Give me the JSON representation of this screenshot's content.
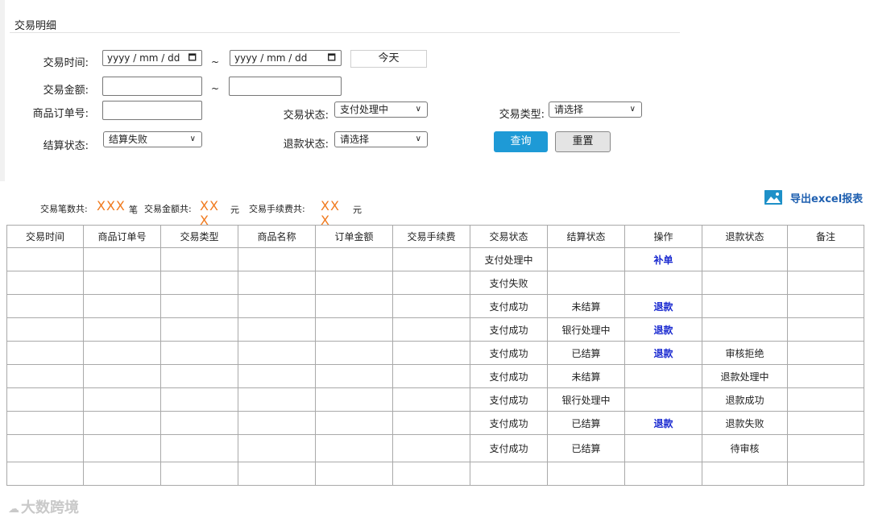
{
  "section": {
    "title": "交易明细"
  },
  "filters": {
    "trade_time_label": "交易时间:",
    "date_start_placeholder": "yyyy / mm / dd",
    "date_end_placeholder": "yyyy / mm / dd",
    "range_sep": "~",
    "today_button": "今天",
    "amount_label": "交易金额:",
    "order_no_label": "商品订单号:",
    "trade_status_label": "交易状态:",
    "trade_status_value": "支付处理中",
    "trade_type_label": "交易类型:",
    "trade_type_value": "请选择",
    "settle_status_label": "结算状态:",
    "settle_status_value": "结算失败",
    "refund_status_label": "退款状态:",
    "refund_status_value": "请选择",
    "query_button": "查询",
    "reset_button": "重置"
  },
  "summary": {
    "count_label": "交易笔数共:",
    "count_value": "XXX",
    "count_unit": "笔",
    "amount_label": "交易金额共:",
    "amount_value_line1": "XX",
    "amount_value_line2": "X",
    "amount_unit": "元",
    "fee_label": "交易手续费共:",
    "fee_value_line1": "XX",
    "fee_value_line2": "X",
    "fee_unit": "元"
  },
  "export": {
    "label": "导出excel报表",
    "icon": "image-icon"
  },
  "table": {
    "columns": [
      "交易时间",
      "商品订单号",
      "交易类型",
      "商品名称",
      "订单金额",
      "交易手续费",
      "交易状态",
      "结算状态",
      "操作",
      "退款状态",
      "备注"
    ],
    "rows": [
      [
        "",
        "",
        "",
        "",
        "",
        "",
        "支付处理中",
        "",
        "补单",
        "",
        ""
      ],
      [
        "",
        "",
        "",
        "",
        "",
        "",
        "支付失败",
        "",
        "",
        "",
        ""
      ],
      [
        "",
        "",
        "",
        "",
        "",
        "",
        "支付成功",
        "未结算",
        "退款",
        "",
        ""
      ],
      [
        "",
        "",
        "",
        "",
        "",
        "",
        "支付成功",
        "银行处理中",
        "退款",
        "",
        ""
      ],
      [
        "",
        "",
        "",
        "",
        "",
        "",
        "支付成功",
        "已结算",
        "退款",
        "审核拒绝",
        ""
      ],
      [
        "",
        "",
        "",
        "",
        "",
        "",
        "支付成功",
        "未结算",
        "",
        "退款处理中",
        ""
      ],
      [
        "",
        "",
        "",
        "",
        "",
        "",
        "支付成功",
        "银行处理中",
        "",
        "退款成功",
        ""
      ],
      [
        "",
        "",
        "",
        "",
        "",
        "",
        "支付成功",
        "已结算",
        "退款",
        "退款失败",
        ""
      ],
      [
        "",
        "",
        "",
        "",
        "",
        "",
        "支付成功",
        "已结算",
        "",
        "待审核",
        ""
      ],
      [
        "",
        "",
        "",
        "",
        "",
        "",
        "",
        "",
        "",
        "",
        ""
      ]
    ]
  },
  "watermark": {
    "text": "大数跨境"
  },
  "colors": {
    "accent": "#1e9ad6",
    "orange": "#f07a1e",
    "link": "#1a2ad0"
  }
}
